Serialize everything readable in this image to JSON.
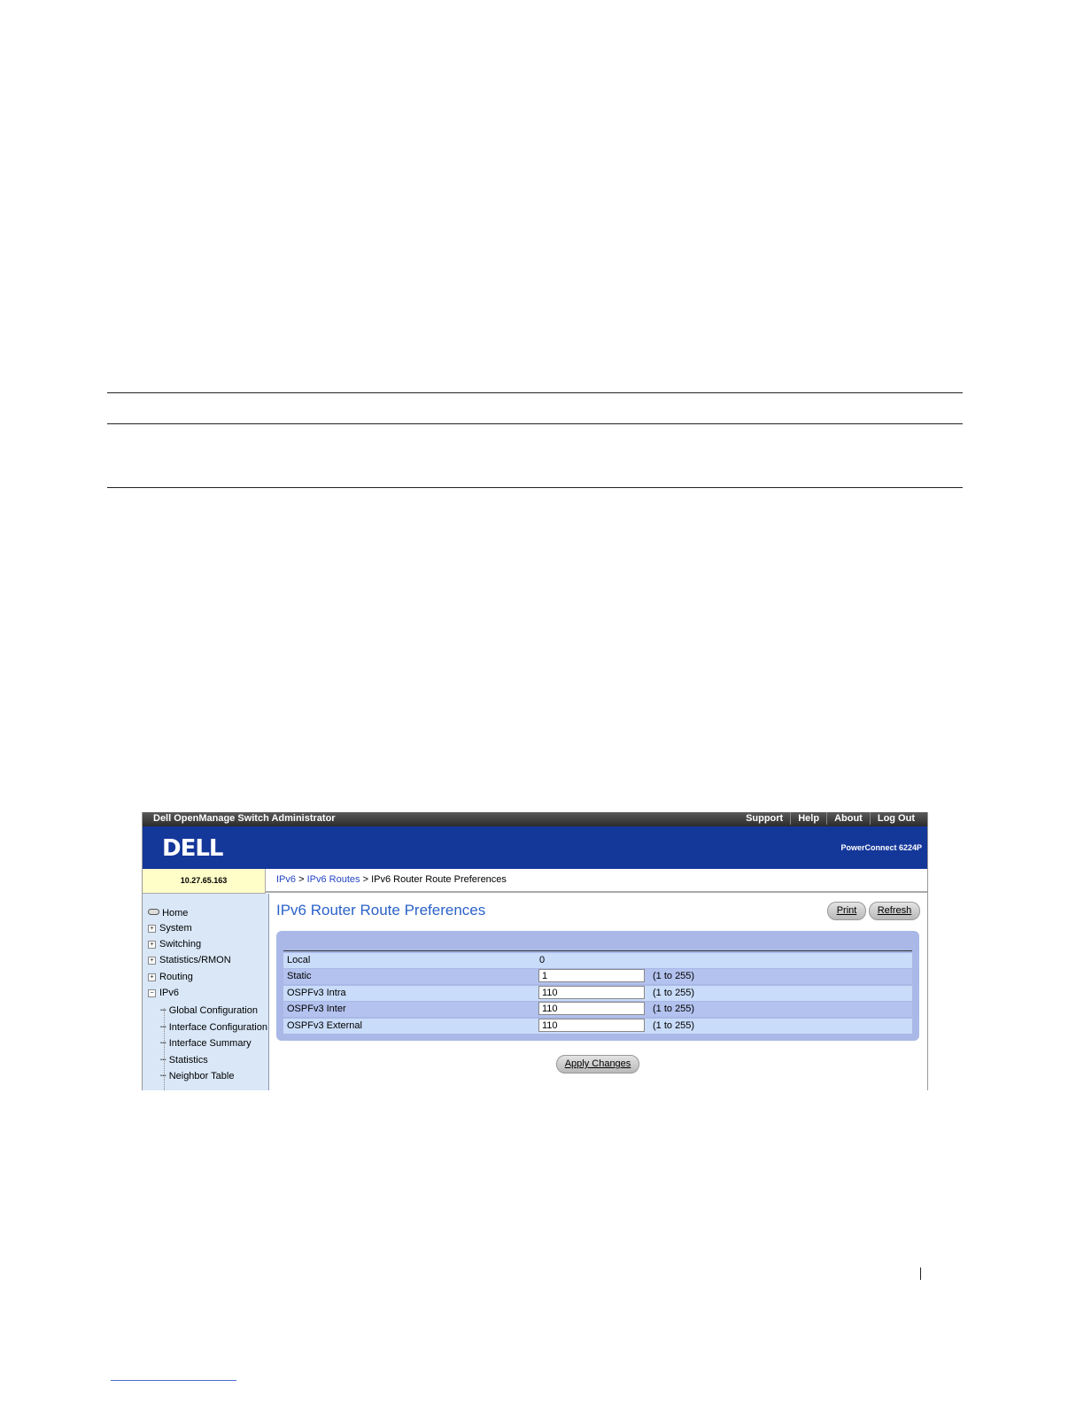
{
  "header": {
    "app_title": "Dell OpenManage Switch Administrator",
    "links": [
      "Support",
      "Help",
      "About",
      "Log Out"
    ],
    "logo_text": "DELL",
    "model": "PowerConnect 6224P"
  },
  "ip_address": "10.27.65.163",
  "breadcrumb": {
    "items": [
      "IPv6",
      "IPv6 Routes"
    ],
    "separator": ">",
    "current": "IPv6 Router Route Preferences"
  },
  "sidebar": {
    "home": "Home",
    "items": [
      "System",
      "Switching",
      "Statistics/RMON",
      "Routing",
      "IPv6"
    ],
    "ipv6_children": [
      "Global Configuration",
      "Interface Configuration",
      "Interface Summary",
      "Statistics",
      "Neighbor Table"
    ]
  },
  "page": {
    "title": "IPv6 Router Route Preferences",
    "print_label": "Print",
    "refresh_label": "Refresh",
    "apply_label": "Apply Changes"
  },
  "preferences": [
    {
      "label": "Local",
      "value": "0",
      "editable": false,
      "range": ""
    },
    {
      "label": "Static",
      "value": "1",
      "editable": true,
      "range": "(1 to 255)"
    },
    {
      "label": "OSPFv3 Intra",
      "value": "110",
      "editable": true,
      "range": "(1 to 255)"
    },
    {
      "label": "OSPFv3 Inter",
      "value": "110",
      "editable": true,
      "range": "(1 to 255)"
    },
    {
      "label": "OSPFv3 External",
      "value": "110",
      "editable": true,
      "range": "(1 to 255)"
    }
  ],
  "colors": {
    "banner": "#14379a",
    "title": "#2b62c8",
    "panel": "#a9b8e6",
    "sidebar": "#d9e7f7"
  }
}
